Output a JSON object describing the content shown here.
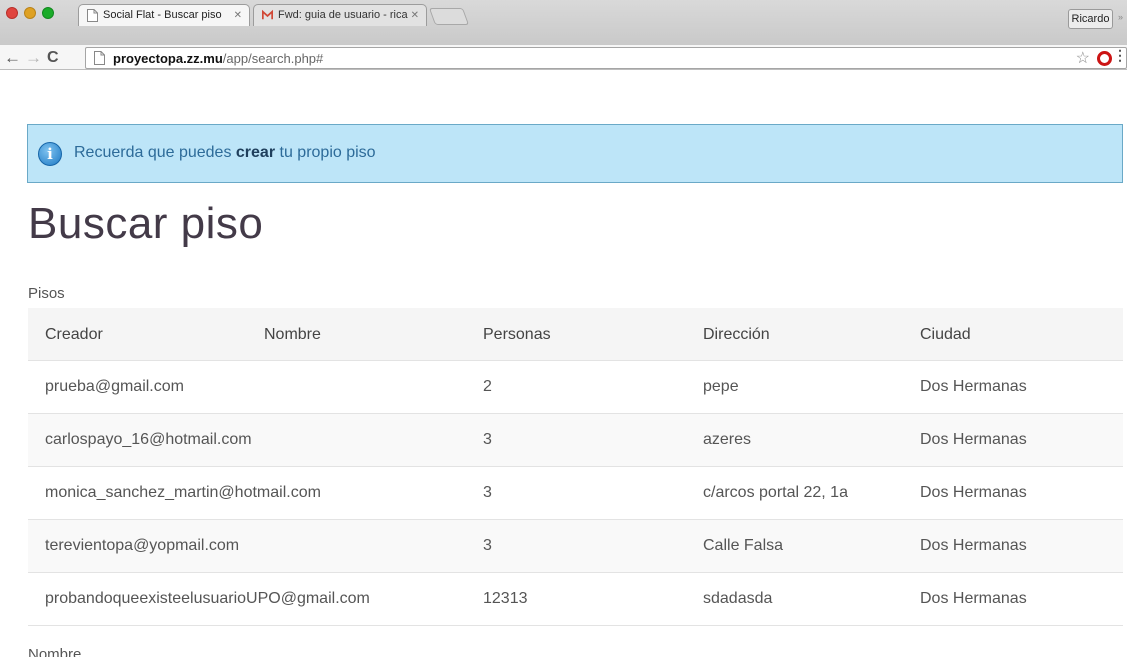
{
  "browser": {
    "tabs": [
      {
        "title": "Social Flat - Buscar piso",
        "active": true
      },
      {
        "title": "Fwd: guia de usuario - rica",
        "active": false
      }
    ],
    "profile_name": "Ricardo",
    "profile_extra": "»",
    "url_host": "proyectopa.zz.mu",
    "url_path": "/app/search.php#",
    "colors": {
      "gmail": "#d14836",
      "opera": "#cc1414"
    }
  },
  "alert": {
    "icon": "info-icon",
    "text_before": "Recuerda que puedes ",
    "link": "crear",
    "text_after": " tu propio piso",
    "background": "#bde5f8"
  },
  "page": {
    "title": "Buscar piso",
    "section_label": "Pisos",
    "next_section_label": "Nombre"
  },
  "table": {
    "headers": [
      "Creador",
      "Nombre",
      "Personas",
      "Dirección",
      "Ciudad"
    ],
    "rows": [
      {
        "creador": "prueba@gmail.com",
        "nombre": "",
        "personas": "2",
        "direccion": "pepe",
        "ciudad": "Dos Hermanas"
      },
      {
        "creador": "carlospayo_16@hotmail.com",
        "nombre": "",
        "personas": "3",
        "direccion": "azeres",
        "ciudad": "Dos Hermanas"
      },
      {
        "creador": "monica_sanchez_martin@hotmail.com",
        "nombre": "",
        "personas": "3",
        "direccion": "c/arcos portal 22, 1a",
        "ciudad": "Dos Hermanas"
      },
      {
        "creador": "terevientopa@yopmail.com",
        "nombre": "",
        "personas": "3",
        "direccion": "Calle Falsa",
        "ciudad": "Dos Hermanas"
      },
      {
        "creador": "probandoqueexisteelusuarioUPO@gmail.com",
        "nombre": "",
        "personas": "12313",
        "direccion": "sdadasda",
        "ciudad": "Dos Hermanas"
      }
    ]
  }
}
